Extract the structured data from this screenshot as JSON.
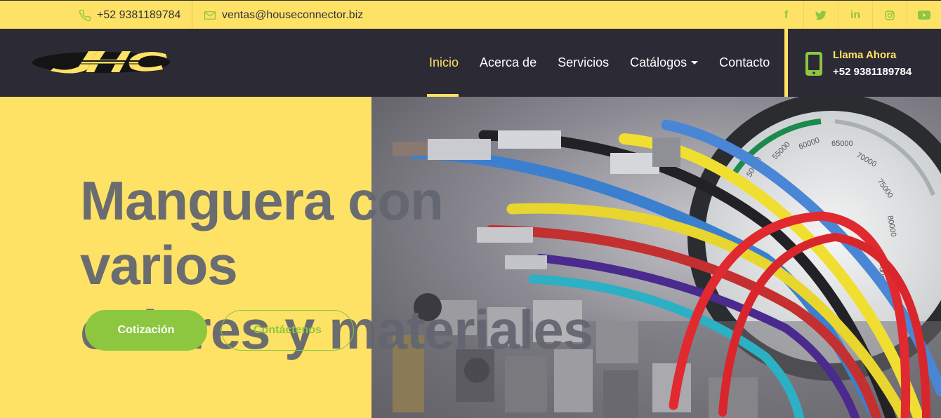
{
  "topbar": {
    "phone": "+52 9381189784",
    "email": "ventas@houseconnector.biz",
    "socials": [
      {
        "name": "facebook-icon",
        "glyph": "f"
      },
      {
        "name": "twitter-icon",
        "glyph": "🐦"
      },
      {
        "name": "linkedin-icon",
        "glyph": "in"
      },
      {
        "name": "instagram-icon",
        "glyph": "◎"
      },
      {
        "name": "youtube-icon",
        "glyph": "▶"
      }
    ]
  },
  "navbar": {
    "logo_text": "JHC",
    "items": [
      {
        "label": "Inicio",
        "active": true
      },
      {
        "label": "Acerca de",
        "active": false
      },
      {
        "label": "Servicios",
        "active": false
      },
      {
        "label": "Catálogos",
        "active": false,
        "dropdown": true
      },
      {
        "label": "Contacto",
        "active": false
      }
    ],
    "callnow": {
      "label": "Llama Ahora",
      "number": "+52 9381189784"
    }
  },
  "hero": {
    "title_line1": "Manguera con varios",
    "title_line2": "colores y materiales",
    "primary_button": "Cotización",
    "secondary_button": "Contáctenos"
  },
  "colors": {
    "accent_yellow": "#fee265",
    "dark_navy": "#2b2a35",
    "green": "#8dc63f",
    "title_gray": "#636670"
  }
}
